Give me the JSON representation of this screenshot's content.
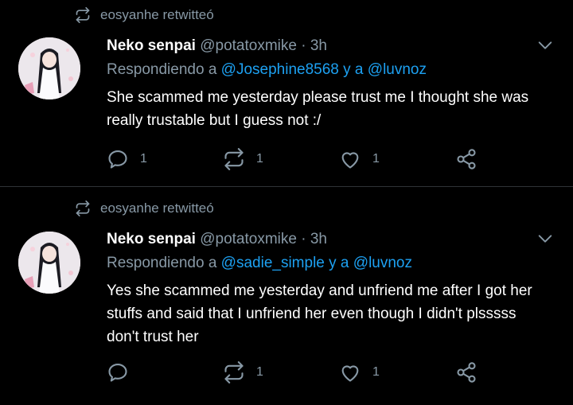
{
  "tweets": [
    {
      "retweeted_by": "eosyanhe retwitteó",
      "display_name": "Neko senpai",
      "handle": "@potatoxmike",
      "dot": "·",
      "time": "3h",
      "reply_prefix": "Respondiendo a",
      "mention_1": "@Josephine8568",
      "reply_join": "y a",
      "mention_2": "@luvnoz",
      "text": "She scammed me yesterday please trust me I thought she was really trustable but I guess not :/",
      "reply_count": "1",
      "retweet_count": "1",
      "like_count": "1"
    },
    {
      "retweeted_by": "eosyanhe retwitteó",
      "display_name": "Neko senpai",
      "handle": "@potatoxmike",
      "dot": "·",
      "time": "3h",
      "reply_prefix": "Respondiendo a",
      "mention_1": "@sadie_simple",
      "reply_join": "y a",
      "mention_2": "@luvnoz",
      "text": "Yes she scammed me yesterday and unfriend me after I got her stuffs and said that I unfriend her even though I didn't plsssss don't trust her",
      "reply_count": "",
      "retweet_count": "1",
      "like_count": "1"
    }
  ],
  "colors": {
    "background": "#000000",
    "secondary_text": "#8899a6",
    "link": "#1da1f2",
    "divider": "#2f3336"
  },
  "icons": [
    "retweet-icon",
    "chevron-down-icon",
    "reply-icon",
    "retweet-icon",
    "like-icon",
    "share-icon"
  ]
}
